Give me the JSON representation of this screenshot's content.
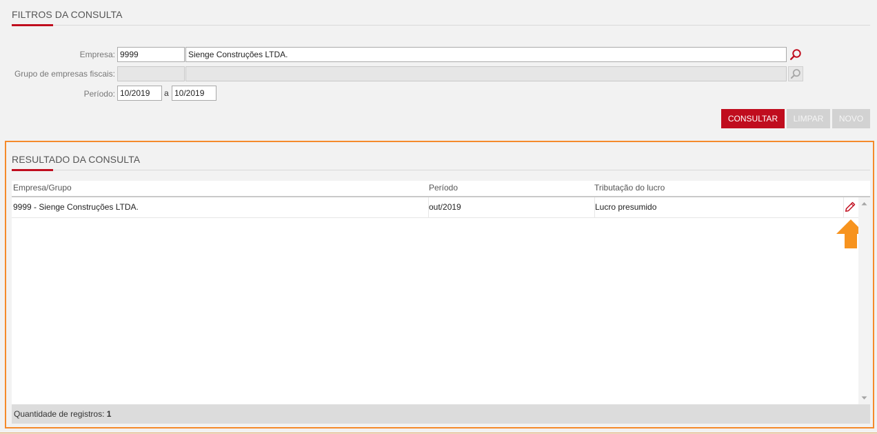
{
  "filters": {
    "title": "FILTROS DA CONSULTA",
    "empresa": {
      "label": "Empresa:",
      "code": "9999",
      "name": "Sienge Construções LTDA."
    },
    "grupo": {
      "label": "Grupo de empresas fiscais:",
      "code": "",
      "name": ""
    },
    "periodo": {
      "label": "Período:",
      "from": "10/2019",
      "separator": "a",
      "to": "10/2019"
    },
    "buttons": {
      "consultar": "CONSULTAR",
      "limpar": "LIMPAR",
      "novo": "NOVO"
    }
  },
  "results": {
    "title": "RESULTADO DA CONSULTA",
    "columns": [
      "Empresa/Grupo",
      "Período",
      "Tributação do lucro"
    ],
    "rows": [
      {
        "empresa": "9999 - Sienge Construções LTDA.",
        "periodo": "out/2019",
        "tributacao": "Lucro presumido"
      }
    ],
    "footer_label": "Quantidade de registros:",
    "footer_count": "1"
  },
  "colors": {
    "accent": "#c00d1e",
    "highlight": "#f58a2a",
    "arrow": "#f7931e"
  },
  "icons": {
    "search": "search-icon",
    "edit": "pencil-icon",
    "arrow": "arrow-up-icon"
  }
}
